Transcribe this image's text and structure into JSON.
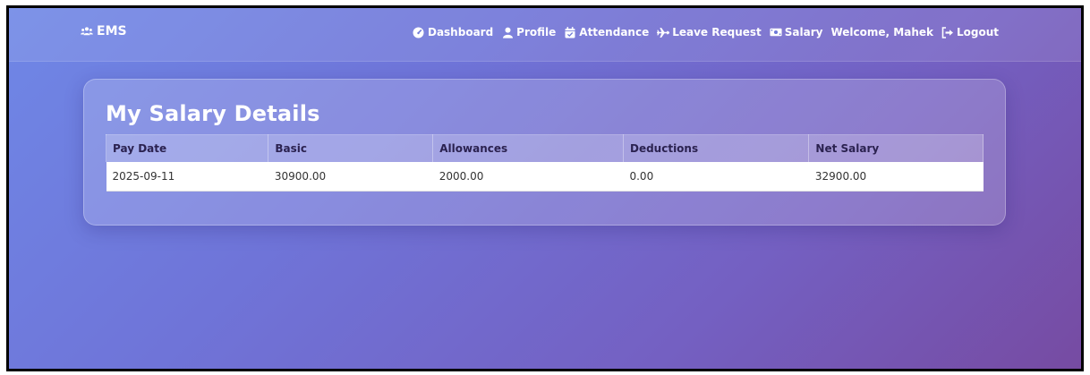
{
  "navbar": {
    "brand": {
      "label": "EMS",
      "icon": "users-icon"
    },
    "links": [
      {
        "label": "Dashboard",
        "icon": "tachometer-icon"
      },
      {
        "label": "Profile",
        "icon": "user-icon"
      },
      {
        "label": "Attendance",
        "icon": "calendar-check-icon"
      },
      {
        "label": "Leave Request",
        "icon": "plane-icon"
      },
      {
        "label": "Salary",
        "icon": "money-icon"
      }
    ],
    "welcome": "Welcome, Mahek",
    "logout": {
      "label": "Logout",
      "icon": "sign-out-icon"
    }
  },
  "page": {
    "title": "My Salary Details"
  },
  "table": {
    "headers": [
      "Pay Date",
      "Basic",
      "Allowances",
      "Deductions",
      "Net Salary"
    ],
    "rows": [
      [
        "2025-09-11",
        "30900.00",
        "2000.00",
        "0.00",
        "32900.00"
      ]
    ]
  },
  "colors": {
    "gradient_start": "#6f87e6",
    "gradient_end": "#764ba2",
    "text_light": "#ffffff",
    "header_text": "#2b2250"
  }
}
